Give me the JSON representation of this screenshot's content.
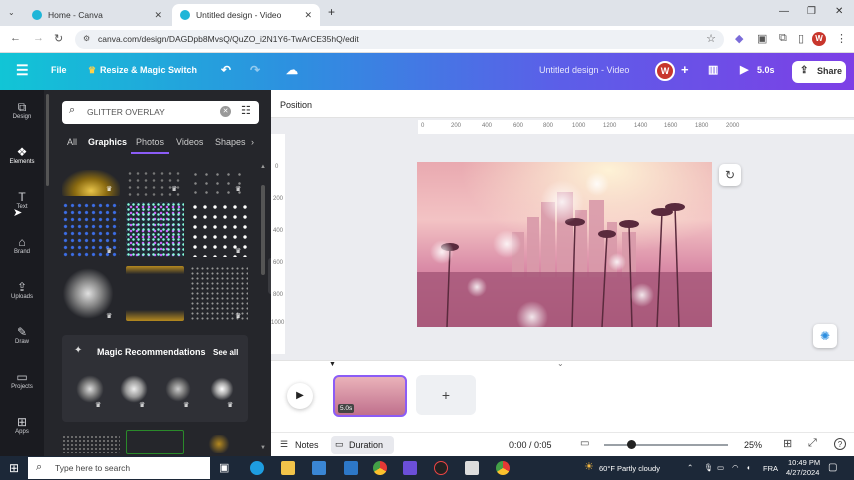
{
  "browser": {
    "tabs": [
      {
        "label": "Home - Canva",
        "close": "✕"
      },
      {
        "label": "Untitled design - Video",
        "close": "✕"
      }
    ],
    "new_tab": "+",
    "url": "canva.com/design/DAGDpb8MvsQ/QuZO_i2N1Y6-TwArCE35hQ/edit"
  },
  "header": {
    "menu": "☰",
    "file": "File",
    "resize": "Resize & Magic Switch",
    "doc_title": "Untitled design - Video",
    "avatar": "W",
    "duration_play": "5.0s",
    "share": "Share"
  },
  "rail": [
    {
      "icon": "⧉",
      "label": "Design"
    },
    {
      "icon": "❖",
      "label": "Elements"
    },
    {
      "icon": "T",
      "label": "Text"
    },
    {
      "icon": "⌂",
      "label": "Brand"
    },
    {
      "icon": "⇪",
      "label": "Uploads"
    },
    {
      "icon": "✎",
      "label": "Draw"
    },
    {
      "icon": "▭",
      "label": "Projects"
    },
    {
      "icon": "⊞",
      "label": "Apps"
    }
  ],
  "panel": {
    "search_value": "GLITTER OVERLAY",
    "tabs": [
      "All",
      "Graphics",
      "Photos",
      "Videos",
      "Shapes"
    ],
    "active_tab": "Graphics",
    "magic_title": "Magic Recommendations",
    "see_all": "See all"
  },
  "canvas": {
    "position_label": "Position",
    "ruler_top": [
      "0",
      "200",
      "400",
      "600",
      "800",
      "1000",
      "1200",
      "1400",
      "1600",
      "1800",
      "2000"
    ],
    "ruler_left": [
      "0",
      "200",
      "400",
      "600",
      "800",
      "1000"
    ]
  },
  "timeline": {
    "clip_duration": "5.0s",
    "add": "+",
    "notes": "Notes",
    "duration": "Duration",
    "time": "0:00 / 0:05",
    "zoom": "25%",
    "help": "?"
  },
  "taskbar": {
    "search_placeholder": "Type here to search",
    "weather": "60°F  Partly cloudy",
    "lang": "FRA",
    "time": "10:49 PM",
    "date": "4/27/2024"
  },
  "colors": {
    "header_gradient_start": "#11c5d6",
    "header_gradient_end": "#7d3fe6",
    "accent": "#8b5cf6",
    "panel_bg": "#25262b",
    "rail_bg": "#1a1b20"
  }
}
